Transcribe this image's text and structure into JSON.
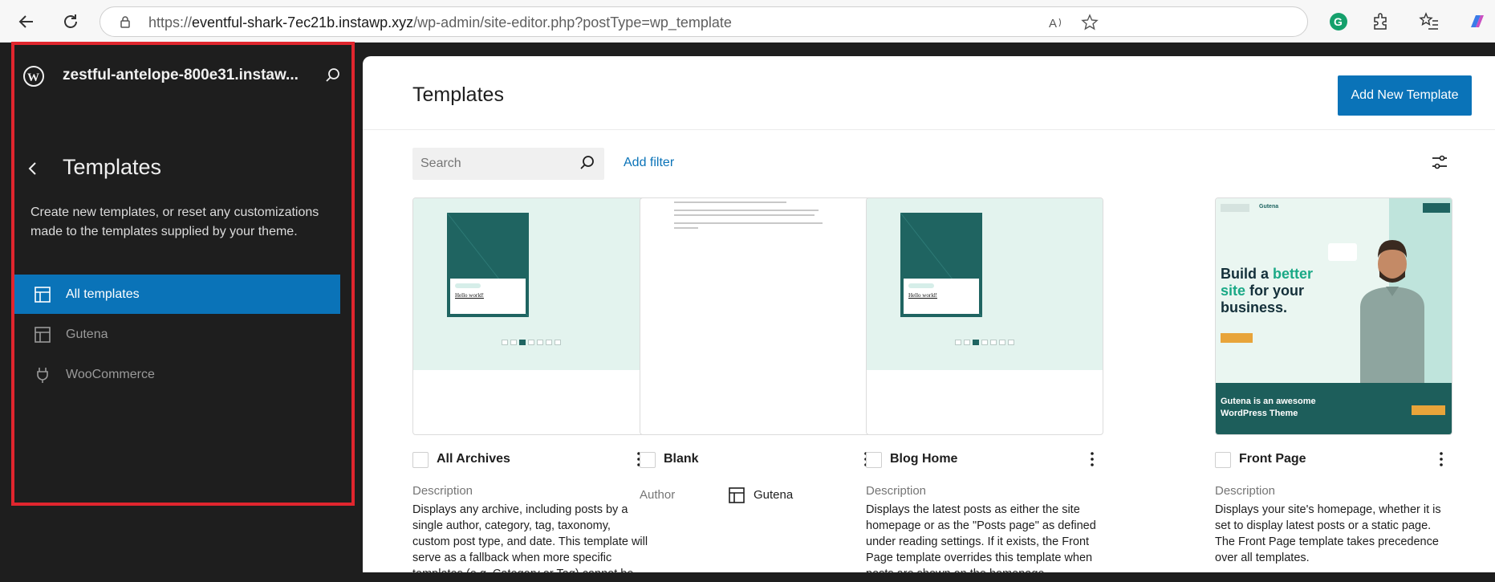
{
  "browser": {
    "url_scheme": "https://",
    "url_host": "eventful-shark-7ec21b.instawp.xyz",
    "url_path": "/wp-admin/site-editor.php?postType=wp_template"
  },
  "sidebar": {
    "site_name": "zestful-antelope-800e31.instaw...",
    "title": "Templates",
    "description": "Create new templates, or reset any customizations made to the templates supplied by your theme.",
    "items": [
      {
        "label": "All templates",
        "icon": "layout-icon",
        "active": true
      },
      {
        "label": "Gutena",
        "icon": "layout-icon",
        "active": false
      },
      {
        "label": "WooCommerce",
        "icon": "plug-icon",
        "active": false
      }
    ]
  },
  "main": {
    "title": "Templates",
    "add_button": "Add New Template",
    "search_placeholder": "Search",
    "add_filter": "Add filter"
  },
  "cards": [
    {
      "title": "All Archives",
      "field_label": "Description",
      "field_text": "Displays any archive, including posts by a single author, category, tag, taxonomy, custom post type, and date. This template will serve as a fallback when more specific templates (e.g. Category or Tag) cannot be"
    },
    {
      "title": "Blank",
      "field_label": "Author",
      "author": "Gutena"
    },
    {
      "title": "Blog Home",
      "field_label": "Description",
      "field_text": "Displays the latest posts as either the site homepage or as the \"Posts page\" as defined under reading settings. If it exists, the Front Page template overrides this template when posts are shown on the homepage."
    },
    {
      "title": "Front Page",
      "field_label": "Description",
      "field_text": "Displays your site's homepage, whether it is set to display latest posts or a static page. The Front Page template takes precedence over all templates."
    }
  ],
  "thumbs": {
    "post_title": "Hello world!",
    "fp_brand": "Gutena",
    "fp_headline_a": "Build a ",
    "fp_headline_b": "better site",
    "fp_headline_c": " for your business.",
    "fp_footer": "Gutena is an awesome WordPress Theme"
  },
  "colors": {
    "accent": "#0a73b8",
    "sidebar_bg": "#1e1e1e",
    "highlight_box": "#e0262e"
  }
}
